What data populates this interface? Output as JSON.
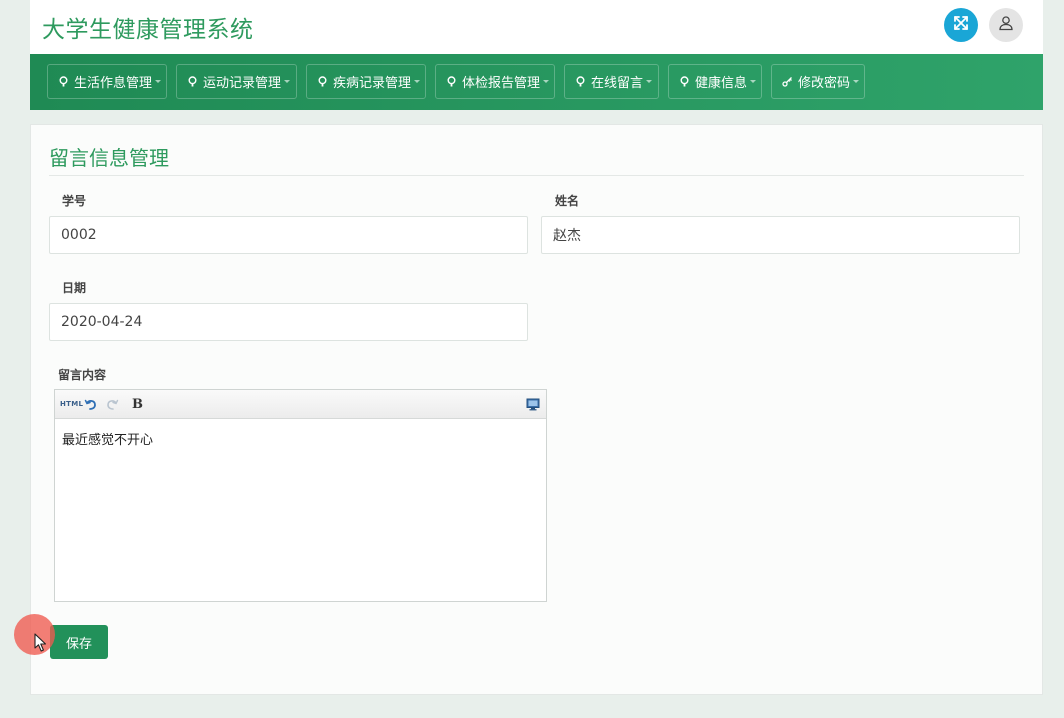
{
  "app": {
    "title": "大学生健康管理系统"
  },
  "header": {
    "fullscreen_icon": "expand-arrows-icon",
    "user_icon": "user-icon"
  },
  "nav": {
    "items": [
      {
        "label": "生活作息管理",
        "icon": "leaf-icon"
      },
      {
        "label": "运动记录管理",
        "icon": "leaf-icon"
      },
      {
        "label": "疾病记录管理",
        "icon": "leaf-icon"
      },
      {
        "label": "体检报告管理",
        "icon": "leaf-icon"
      },
      {
        "label": "在线留言",
        "icon": "leaf-icon"
      },
      {
        "label": "健康信息",
        "icon": "leaf-icon"
      },
      {
        "label": "修改密码",
        "icon": "key-icon"
      }
    ]
  },
  "page": {
    "title": "留言信息管理"
  },
  "form": {
    "student_id": {
      "label": "学号",
      "value": "0002"
    },
    "name": {
      "label": "姓名",
      "value": "赵杰"
    },
    "date": {
      "label": "日期",
      "value": "2020-04-24"
    },
    "message": {
      "label": "留言内容",
      "content": "最近感觉不开心",
      "toolbar": {
        "html_label": "HTML",
        "bold_label": "B"
      }
    },
    "save_label": "保存"
  },
  "colors": {
    "brand_green": "#2e9a5e",
    "nav_green": "#1f8a54",
    "fullscreen_blue": "#1aa6d6",
    "save_green": "#22915a"
  }
}
